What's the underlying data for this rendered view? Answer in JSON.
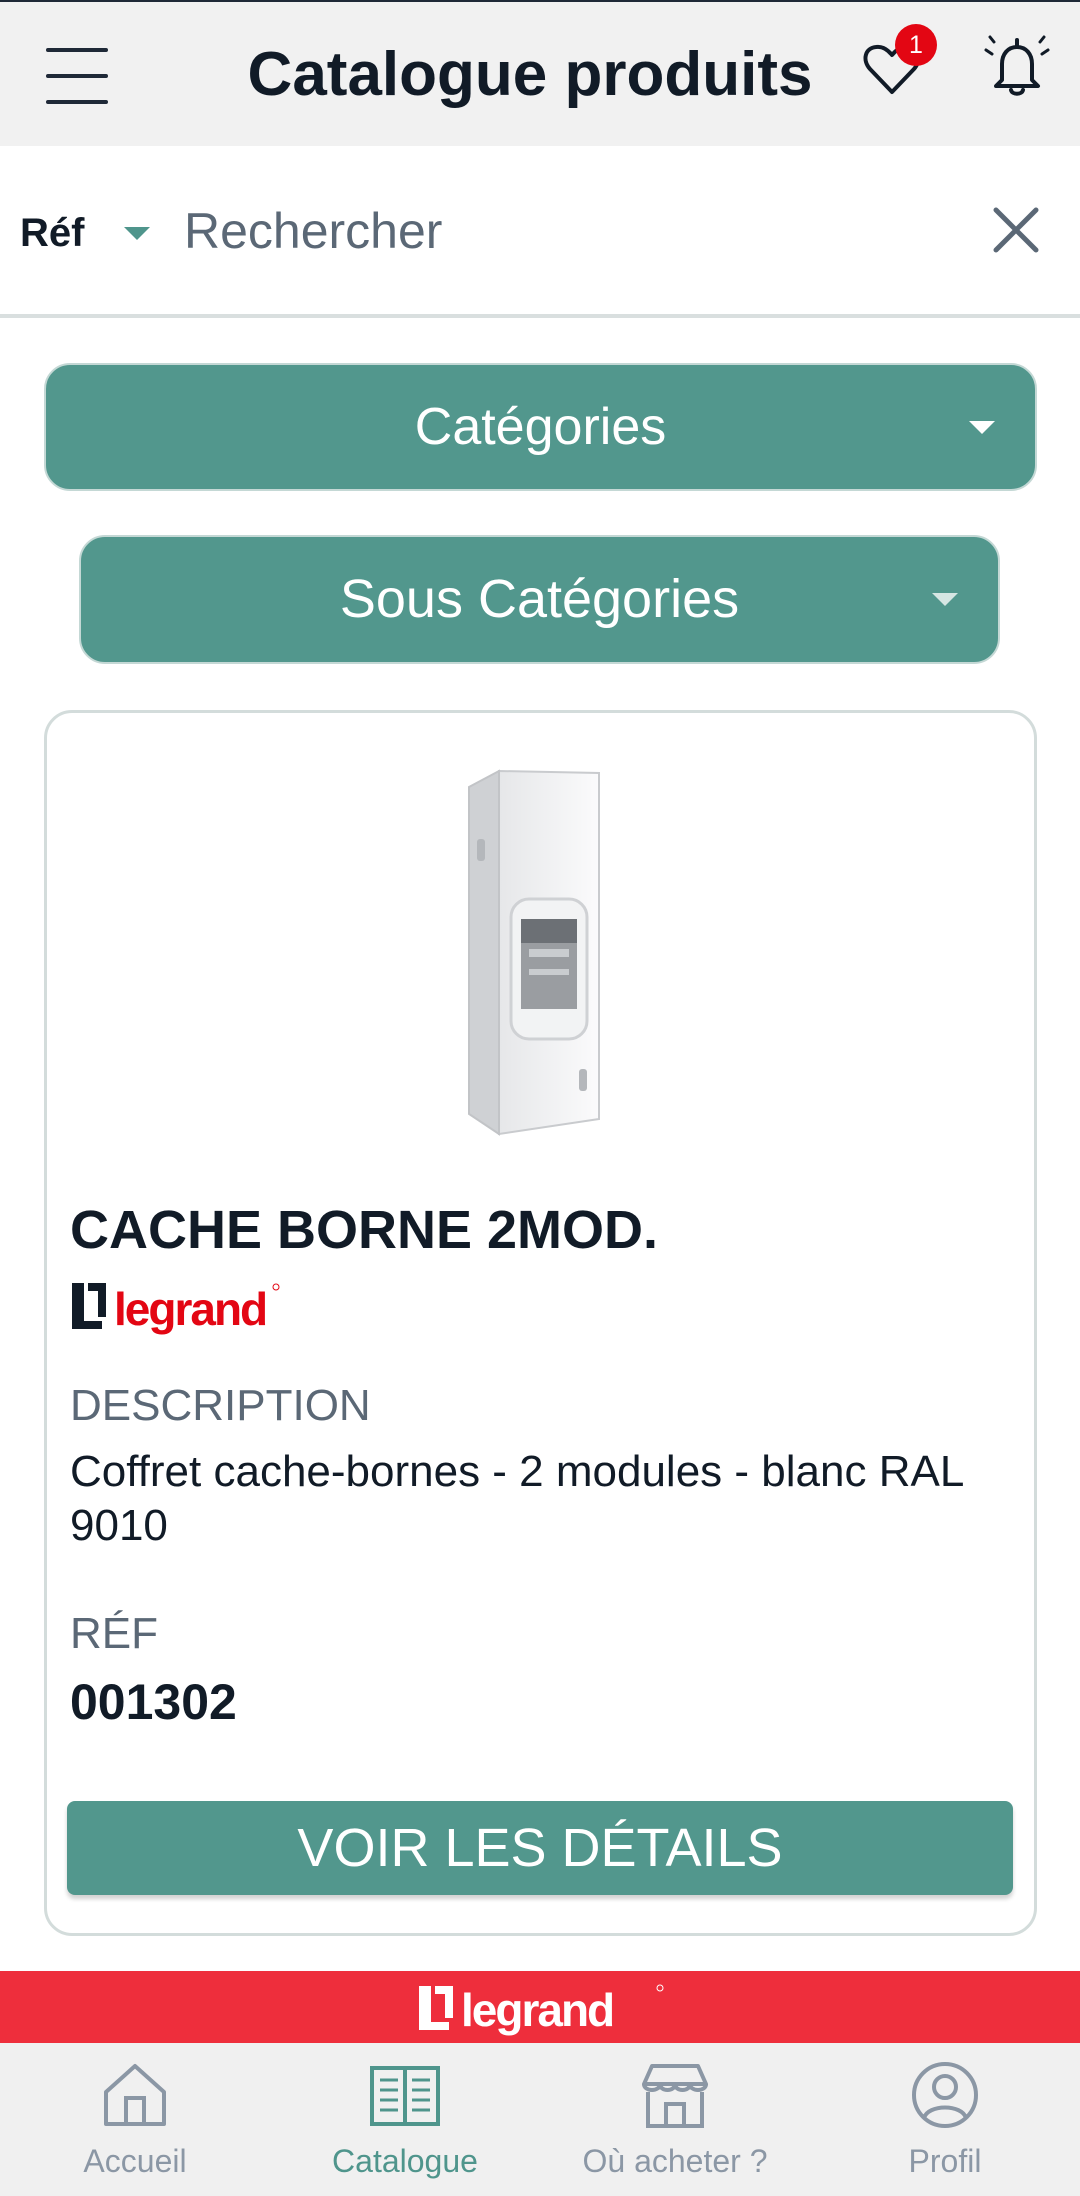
{
  "header": {
    "title": "Catalogue produits",
    "favorites_count": "1"
  },
  "search": {
    "filter_label": "Réf",
    "placeholder": "Rechercher"
  },
  "filters": {
    "categories_label": "Catégories",
    "subcategories_label": "Sous Catégories"
  },
  "product": {
    "name": "CACHE BORNE 2MOD.",
    "brand": "legrand",
    "description_label": "DESCRIPTION",
    "description": "Coffret cache-bornes - 2 modules - blanc RAL 9010",
    "ref_label": "RÉF",
    "ref": "001302",
    "details_button": "VOIR LES DÉTAILS"
  },
  "brand_band": "legrand",
  "bottom_nav": [
    {
      "label": "Accueil",
      "icon": "home-icon",
      "active": false
    },
    {
      "label": "Catalogue",
      "icon": "catalog-book-icon",
      "active": true
    },
    {
      "label": "Où acheter ?",
      "icon": "store-icon",
      "active": false
    },
    {
      "label": "Profil",
      "icon": "profile-icon",
      "active": false
    }
  ],
  "colors": {
    "accent": "#52978d",
    "brand_red": "#ee2e3c",
    "badge_red": "#e30613",
    "text_dark": "#111b27",
    "text_muted": "#5b6876"
  }
}
